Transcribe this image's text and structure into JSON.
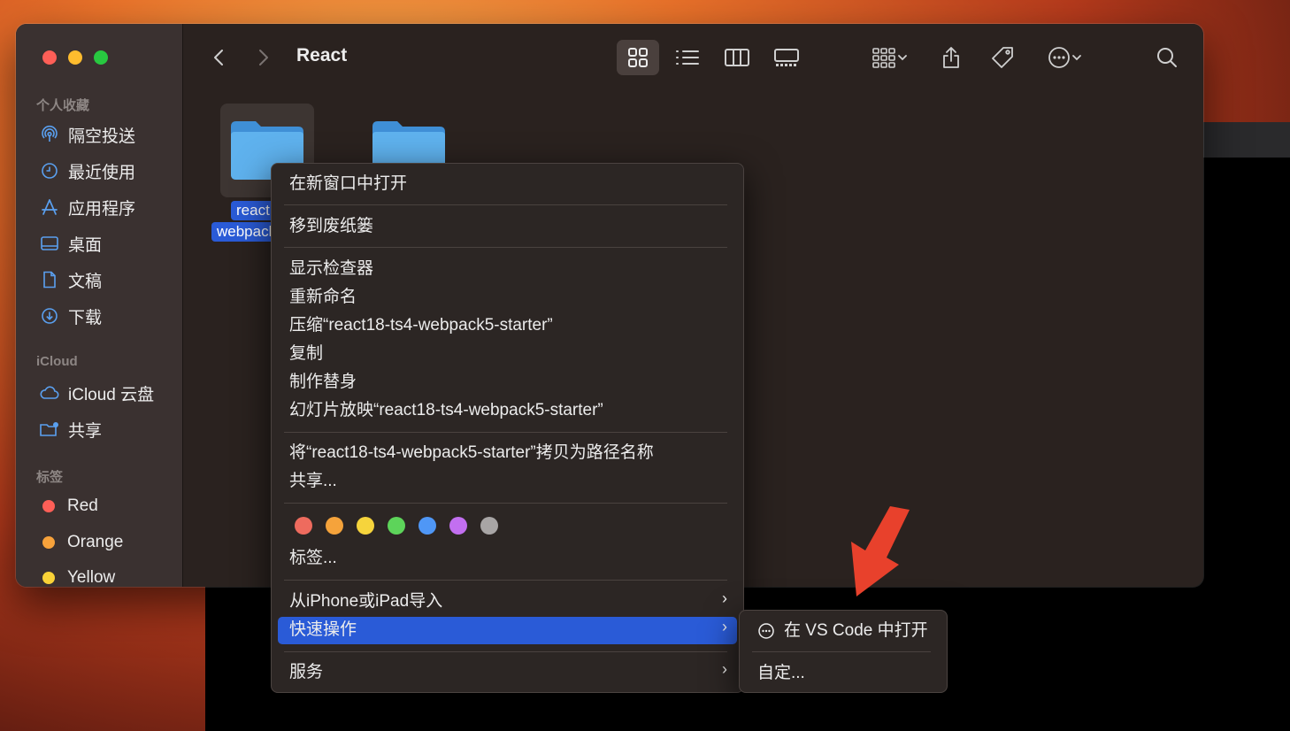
{
  "window": {
    "title": "React"
  },
  "sidebar": {
    "sections": [
      {
        "header": "个人收藏",
        "items": [
          {
            "label": "隔空投送",
            "icon": "airdrop-icon"
          },
          {
            "label": "最近使用",
            "icon": "clock-icon"
          },
          {
            "label": "应用程序",
            "icon": "applications-icon"
          },
          {
            "label": "桌面",
            "icon": "desktop-icon"
          },
          {
            "label": "文稿",
            "icon": "document-icon"
          },
          {
            "label": "下载",
            "icon": "download-icon"
          }
        ]
      },
      {
        "header": "iCloud",
        "items": [
          {
            "label": "iCloud 云盘",
            "icon": "cloud-icon"
          },
          {
            "label": "共享",
            "icon": "shared-folder-icon"
          }
        ]
      },
      {
        "header": "标签",
        "items": [
          {
            "label": "Red",
            "color": "#fe5f57"
          },
          {
            "label": "Orange",
            "color": "#f7a23b"
          },
          {
            "label": "Yellow",
            "color": "#f9d237"
          }
        ]
      }
    ]
  },
  "files": {
    "selected_label_line1": "react18",
    "selected_label_line2": "webpack5"
  },
  "context_menu": {
    "open_new_window": "在新窗口中打开",
    "move_to_trash": "移到废纸篓",
    "get_info": "显示检查器",
    "rename": "重新命名",
    "compress": "压缩“react18-ts4-webpack5-starter”",
    "duplicate": "复制",
    "make_alias": "制作替身",
    "quick_look": "幻灯片放映“react18-ts4-webpack5-starter”",
    "copy_path": "将“react18-ts4-webpack5-starter”拷贝为路径名称",
    "share": "共享...",
    "tag_colors": [
      "#ee6b5e",
      "#f5a33b",
      "#f6d43c",
      "#5dd45a",
      "#4f97f6",
      "#c26ff0",
      "#a8a5a5"
    ],
    "tags": "标签...",
    "import_iphone": "从iPhone或iPad导入",
    "quick_actions": "快速操作",
    "services": "服务",
    "chevron": "›"
  },
  "submenu": {
    "open_vscode": "在 VS Code 中打开",
    "customize": "自定..."
  },
  "colors": {
    "accent": "#2a5bd7",
    "arrow": "#e8412c"
  }
}
